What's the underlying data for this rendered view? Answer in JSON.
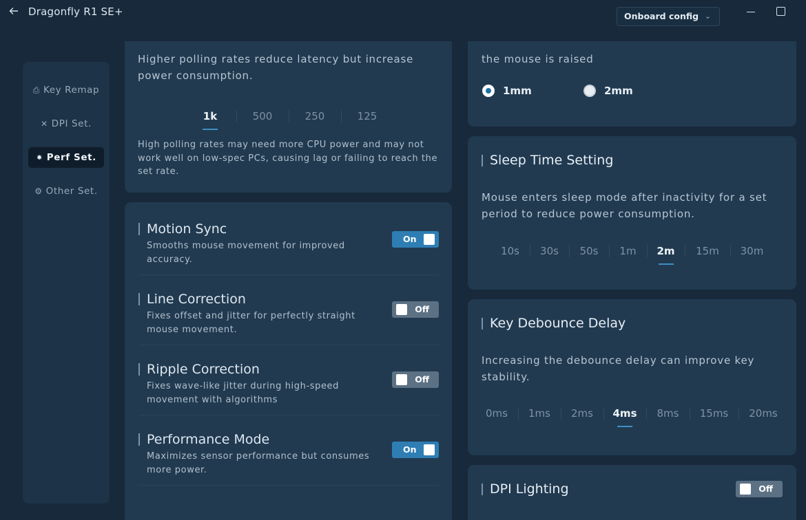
{
  "window": {
    "title": "Dragonfly R1 SE+",
    "config_select": "Onboard config",
    "icons": [
      "back-arrow-icon",
      "minimize-icon",
      "maximize-icon",
      "chevron-down-icon"
    ]
  },
  "sidebar": {
    "items": [
      {
        "label": "Key Remap",
        "icon": "keyboard-icon",
        "active": false
      },
      {
        "label": "DPI Set.",
        "icon": "crosshair-icon",
        "active": false
      },
      {
        "label": "Perf Set.",
        "icon": "sparkle-icon",
        "active": true
      },
      {
        "label": "Other Set.",
        "icon": "gear-icon",
        "active": false
      }
    ]
  },
  "polling": {
    "desc": "Higher polling rates reduce latency but increase power consumption.",
    "options": [
      "1k",
      "500",
      "250",
      "125"
    ],
    "selected": "1k",
    "note": "High polling rates may need more CPU power and may not work well on low-spec PCs, causing lag or failing to reach the set rate."
  },
  "features": [
    {
      "title": "Motion Sync",
      "desc": "Smooths mouse movement for improved accuracy.",
      "state": "On"
    },
    {
      "title": "Line Correction",
      "desc": "Fixes offset and jitter for perfectly straight mouse movement.",
      "state": "Off"
    },
    {
      "title": "Ripple Correction",
      "desc": "Fixes wave-like jitter during high-speed movement with algorithms",
      "state": "Off"
    },
    {
      "title": "Performance Mode",
      "desc": "Maximizes sensor performance but consumes more power.",
      "state": "On"
    }
  ],
  "lod": {
    "desc_tail": "the mouse is raised",
    "options": [
      "1mm",
      "2mm"
    ],
    "selected": "1mm"
  },
  "sleep": {
    "title": "Sleep Time Setting",
    "desc": "Mouse enters sleep mode after inactivity for a set period to reduce power consumption.",
    "options": [
      "10s",
      "30s",
      "50s",
      "1m",
      "2m",
      "15m",
      "30m"
    ],
    "selected": "2m"
  },
  "debounce": {
    "title": "Key Debounce Delay",
    "desc": "Increasing the debounce delay can improve key stability.",
    "options": [
      "0ms",
      "1ms",
      "2ms",
      "4ms",
      "8ms",
      "15ms",
      "20ms"
    ],
    "selected": "4ms"
  },
  "dpi_lighting": {
    "title": "DPI Lighting",
    "state": "Off"
  },
  "colors": {
    "background": "#17293b",
    "card": "#213a50",
    "accent": "#2e7eb4",
    "toggle_off": "#5d7184"
  }
}
